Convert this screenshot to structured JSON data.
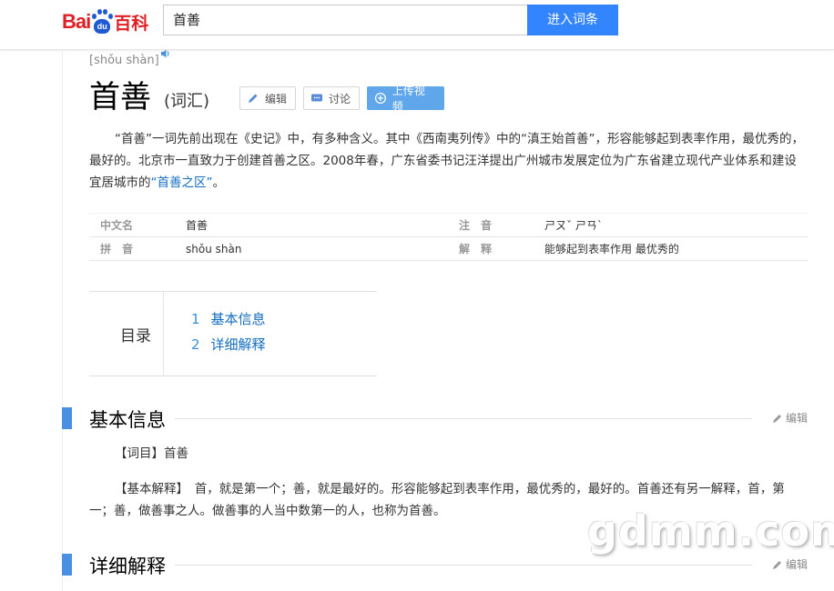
{
  "header": {
    "logo_text_left": "Bai",
    "logo_text_paw": "du",
    "logo_text_right": "百科",
    "search_value": "首善",
    "search_button": "进入词条"
  },
  "entry": {
    "pinyin": "[shǒu shàn]",
    "title": "首善",
    "title_sub": "(词汇)",
    "buttons": {
      "edit": "编辑",
      "discuss": "讨论",
      "upload": "上传视频"
    },
    "summary_pre": "“首善”一词先前出现在《史记》中，有多种含义。其中《西南夷列传》中的“滇王始首善”，形容能够起到表率作用，最优秀的，最好的。北京市一直致力于创建首善之区。2008年春，广东省委书记汪洋提出广州城市发展定位为广东省建立现代产业体系和建设宜居城市的",
    "summary_link": "“首善之区”",
    "summary_post": "。"
  },
  "basic_info": [
    {
      "k1": "中文名",
      "v1": "首善",
      "k2": "注　音",
      "v2": "ㄕㄡˇ ㄕㄢˋ"
    },
    {
      "k1": "拼　音",
      "v1": "shǒu shàn",
      "k2": "解　释",
      "v2": "能够起到表率作用 最优秀的"
    }
  ],
  "toc": {
    "label": "目录",
    "items": [
      {
        "num": "1",
        "label": "基本信息"
      },
      {
        "num": "2",
        "label": "详细解释"
      }
    ]
  },
  "sections": [
    {
      "title": "基本信息",
      "edit": "编辑",
      "paras": [
        "【词目】首善",
        "【基本解释】　首，就是第一个；善，就是最好的。形容能够起到表率作用，最优秀的，最好的。首善还有另一解释，首，第一；善，做善事之人。做善事的人当中数第一的人，也称为首善。"
      ]
    },
    {
      "title": "详细解释",
      "edit": "编辑"
    }
  ],
  "watermark": "gdmm.com",
  "colors": {
    "accent": "#3385ff",
    "link": "#136ec2",
    "section_bar": "#4a90e2",
    "logo_red": "#de1f26",
    "logo_blue": "#1f5ad2"
  }
}
